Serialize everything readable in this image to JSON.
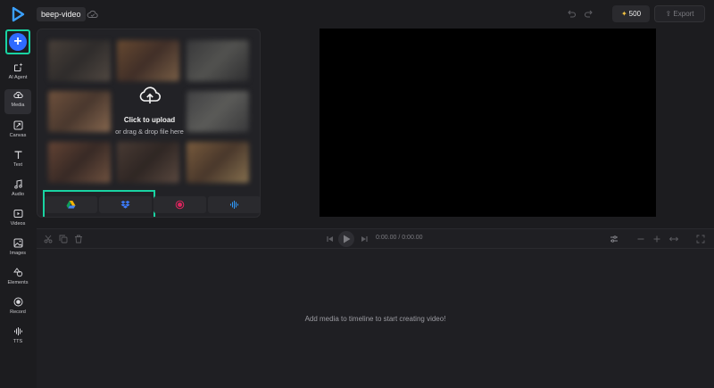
{
  "header": {
    "project_name": "beep-video",
    "credits": "500",
    "export_label": "Export"
  },
  "sidebar": {
    "items": [
      {
        "label": "AI Agent",
        "icon": "ai-agent-icon"
      },
      {
        "label": "Media",
        "icon": "cloud-upload-icon"
      },
      {
        "label": "Canvas",
        "icon": "canvas-icon"
      },
      {
        "label": "Text",
        "icon": "text-icon"
      },
      {
        "label": "Audio",
        "icon": "music-icon"
      },
      {
        "label": "Videos",
        "icon": "video-icon"
      },
      {
        "label": "Images",
        "icon": "image-icon"
      },
      {
        "label": "Elements",
        "icon": "shapes-icon"
      },
      {
        "label": "Record",
        "icon": "record-icon"
      },
      {
        "label": "TTS",
        "icon": "tts-icon"
      }
    ]
  },
  "media": {
    "upload_title": "Click to upload",
    "upload_subtitle": "or drag & drop file here"
  },
  "timeline": {
    "current_time": "0:00.00",
    "separator": "/",
    "total_time": "0:00.00",
    "empty_message": "Add media to timeline to start creating video!"
  },
  "colors": {
    "accent": "#19d3a2",
    "brand_blue": "#2f6bff",
    "record_red": "#e0245e",
    "credits_star": "#f5c542"
  }
}
